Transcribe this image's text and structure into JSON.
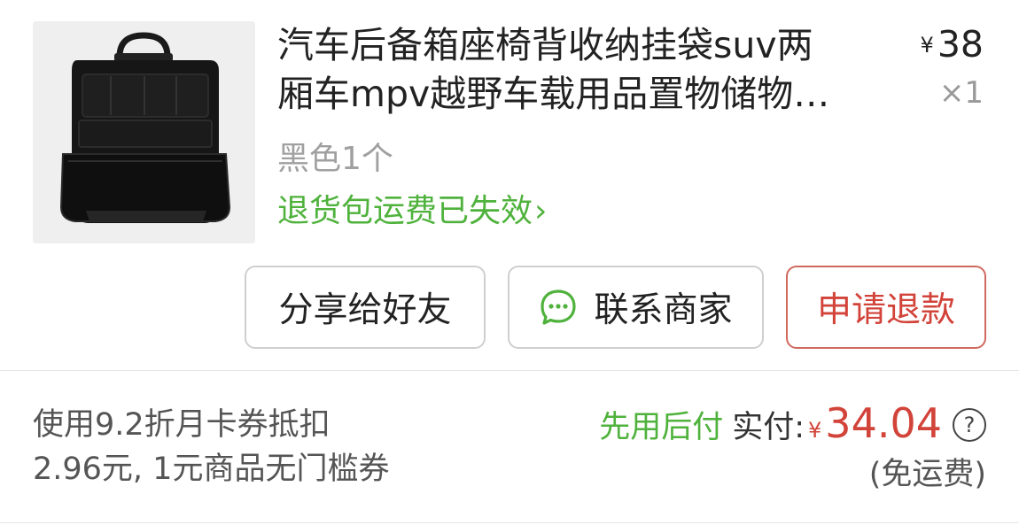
{
  "product": {
    "title_line1": "汽车后备箱座椅背收纳挂袋suv两",
    "title_line2": "厢车mpv越野车载用品置物储物…",
    "currency": "¥",
    "price": "38",
    "quantity": "×1",
    "variant": "黑色1个",
    "return_shipping": "退货包运费已失效",
    "return_shipping_chevron": "›",
    "image_icon": "car-seat-organizer-image"
  },
  "actions": {
    "share_label": "分享给好友",
    "contact_label": "联系商家",
    "contact_icon": "chat-bubble-icon",
    "refund_label": "申请退款"
  },
  "summary": {
    "coupon_line1": "使用9.2折月卡券抵扣",
    "coupon_line2": "2.96元, 1元商品无门槛券",
    "pay_later": "先用后付",
    "paid_label": "实付:",
    "paid_currency": "¥",
    "paid_amount": "34.04",
    "help_icon_glyph": "?",
    "shipping_note": "(免运费)"
  },
  "colors": {
    "green": "#4fb23c",
    "red": "#d2433a",
    "refund_border": "#d06a5e",
    "muted": "#a0a0a0"
  }
}
